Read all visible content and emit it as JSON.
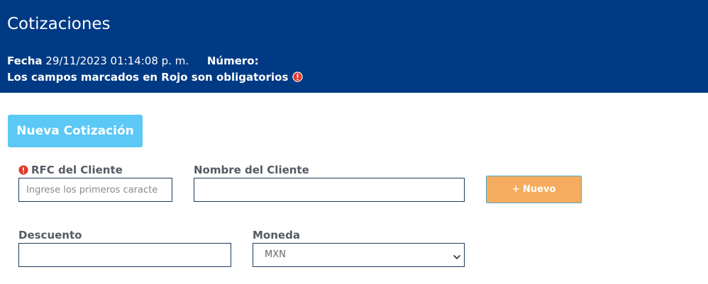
{
  "header": {
    "title": "Cotizaciones",
    "fecha_label": "Fecha",
    "fecha_value": "29/11/2023 01:14:08 p. m.",
    "numero_label": "Número:",
    "numero_value": "",
    "required_note": "Los campos marcados en Rojo son obligatorios"
  },
  "actions": {
    "new_quote_label": "Nueva Cotización",
    "new_client_label": "+ Nuevo"
  },
  "form": {
    "rfc": {
      "label": "RFC del Cliente",
      "placeholder": "Ingrese los primeros caracte",
      "value": "",
      "required": true
    },
    "client_name": {
      "label": "Nombre del Cliente",
      "value": ""
    },
    "discount": {
      "label": "Descuento",
      "value": ""
    },
    "currency": {
      "label": "Moneda",
      "selected": "MXN"
    }
  },
  "icons": {
    "required_alert": "alert-circle-icon",
    "select_caret": "chevron-down-icon"
  },
  "colors": {
    "header_bg": "#003a84",
    "new_quote_bg": "#5bc8f5",
    "new_client_bg": "#f6ac5e",
    "required_red": "#e0392b"
  }
}
